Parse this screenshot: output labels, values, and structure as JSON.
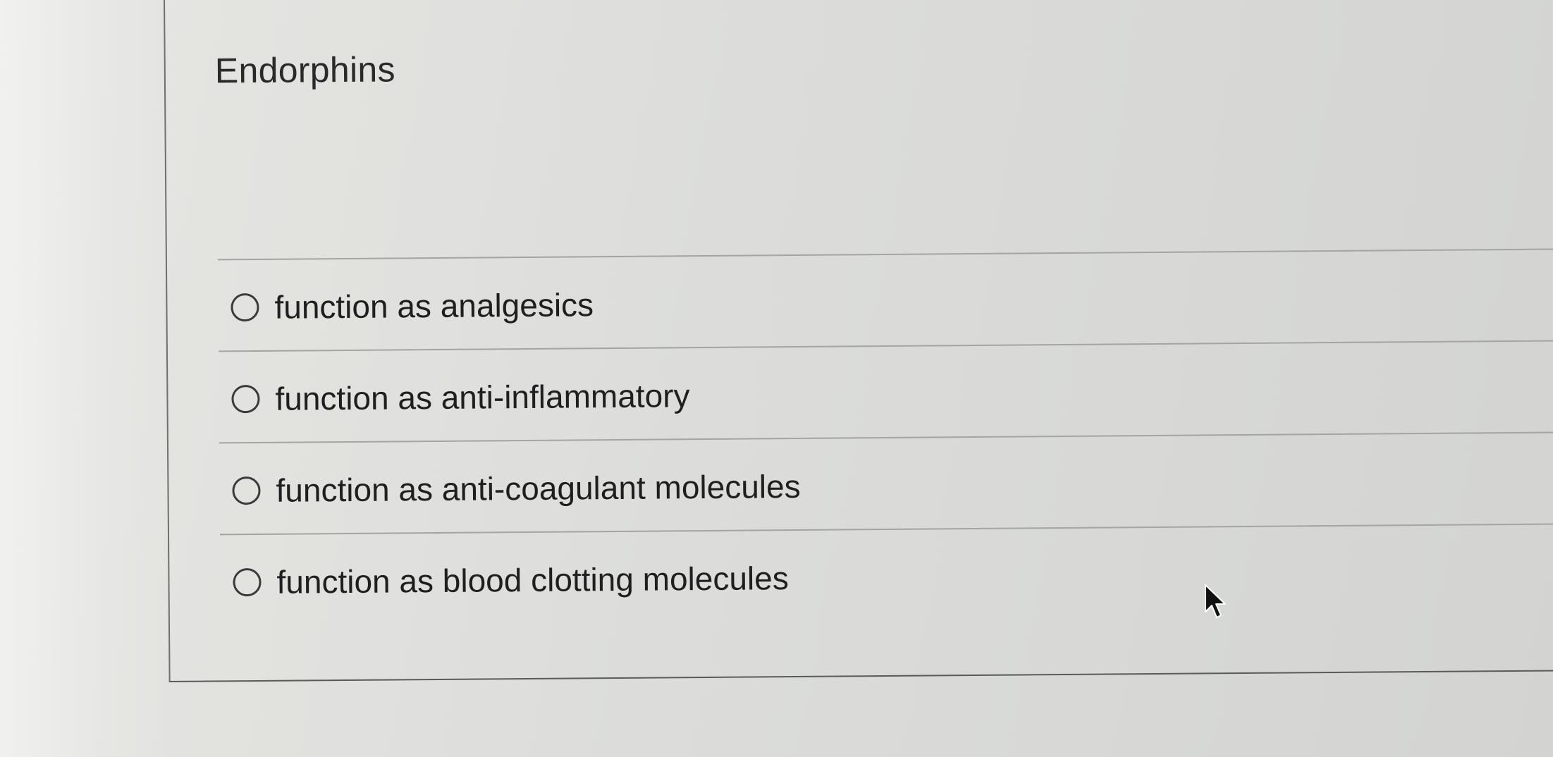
{
  "question": {
    "title": "Endorphins",
    "options": [
      {
        "label": "function as analgesics",
        "selected": false
      },
      {
        "label": "function as anti-inflammatory",
        "selected": false
      },
      {
        "label": "function as anti-coagulant molecules",
        "selected": false
      },
      {
        "label": "function as blood clotting molecules",
        "selected": false
      }
    ]
  },
  "icons": {
    "radio": "radio-button-unselected-icon",
    "cursor": "mouse-pointer-icon"
  },
  "colors": {
    "background": "#dcdddb",
    "text": "#1f1f1f",
    "divider": "#a4a4a2",
    "border": "#5a5a5a"
  }
}
